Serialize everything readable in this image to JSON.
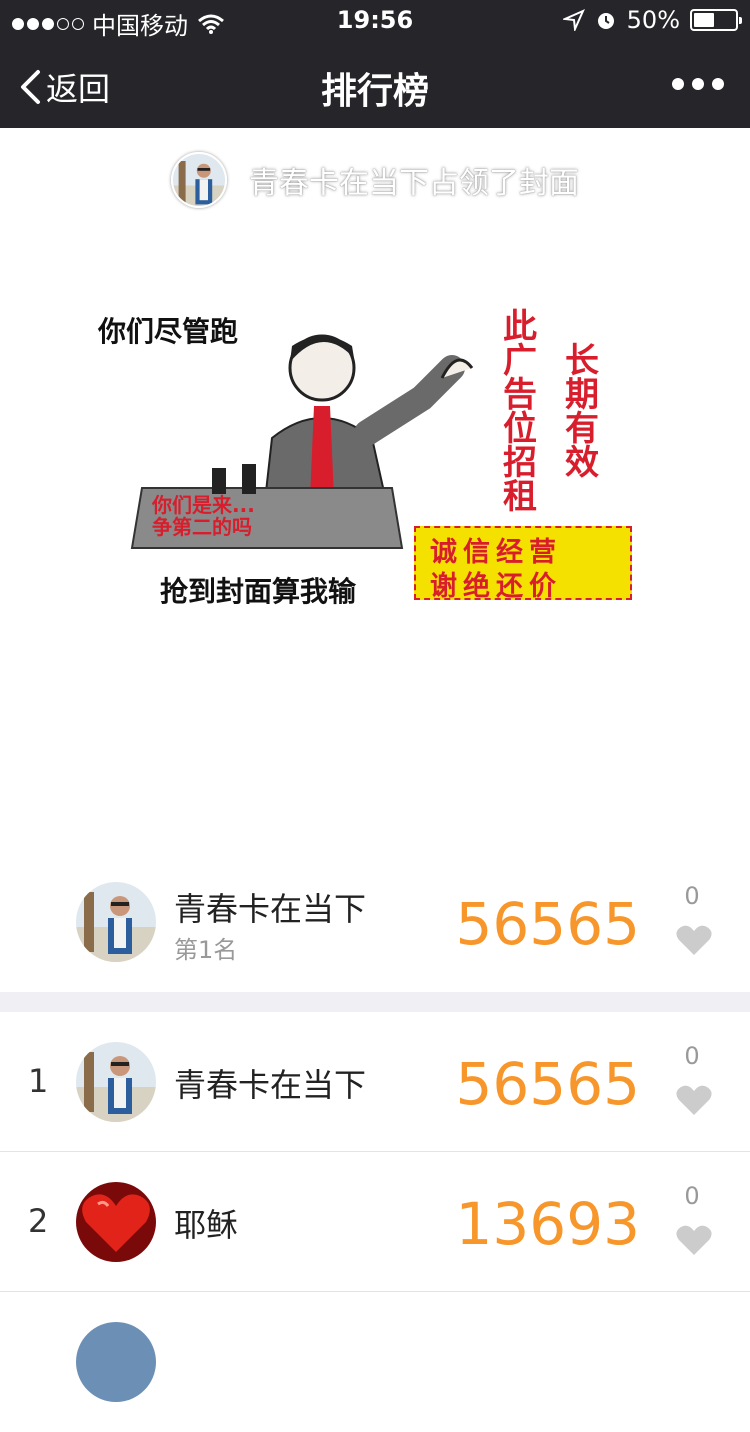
{
  "status_bar": {
    "carrier": "中国移动",
    "time": "19:56",
    "battery": "50%",
    "battery_level": 0.5
  },
  "nav": {
    "back_label": "返回",
    "title": "排行榜"
  },
  "cover": {
    "owner_text": "青春卡在当下占领了封面",
    "image_texts": {
      "top_left": "你们尽管跑",
      "podium": "你们是来...\n争第二的吗",
      "bottom": "抢到封面算我输",
      "vertical_1": "此广告位招租",
      "vertical_2": "长期有效",
      "box_line_1": "诚信经营",
      "box_line_2": "谢绝还价"
    }
  },
  "me": {
    "name": "青春卡在当下",
    "rank_text": "第1名",
    "score": "56565",
    "likes": "0"
  },
  "ranking": [
    {
      "rank": "1",
      "name": "青春卡在当下",
      "score": "56565",
      "likes": "0"
    },
    {
      "rank": "2",
      "name": "耶稣",
      "score": "13693",
      "likes": "0"
    }
  ],
  "colors": {
    "score": "#f7962a",
    "nav_bg": "#25252a",
    "heart": "#cccccc"
  }
}
